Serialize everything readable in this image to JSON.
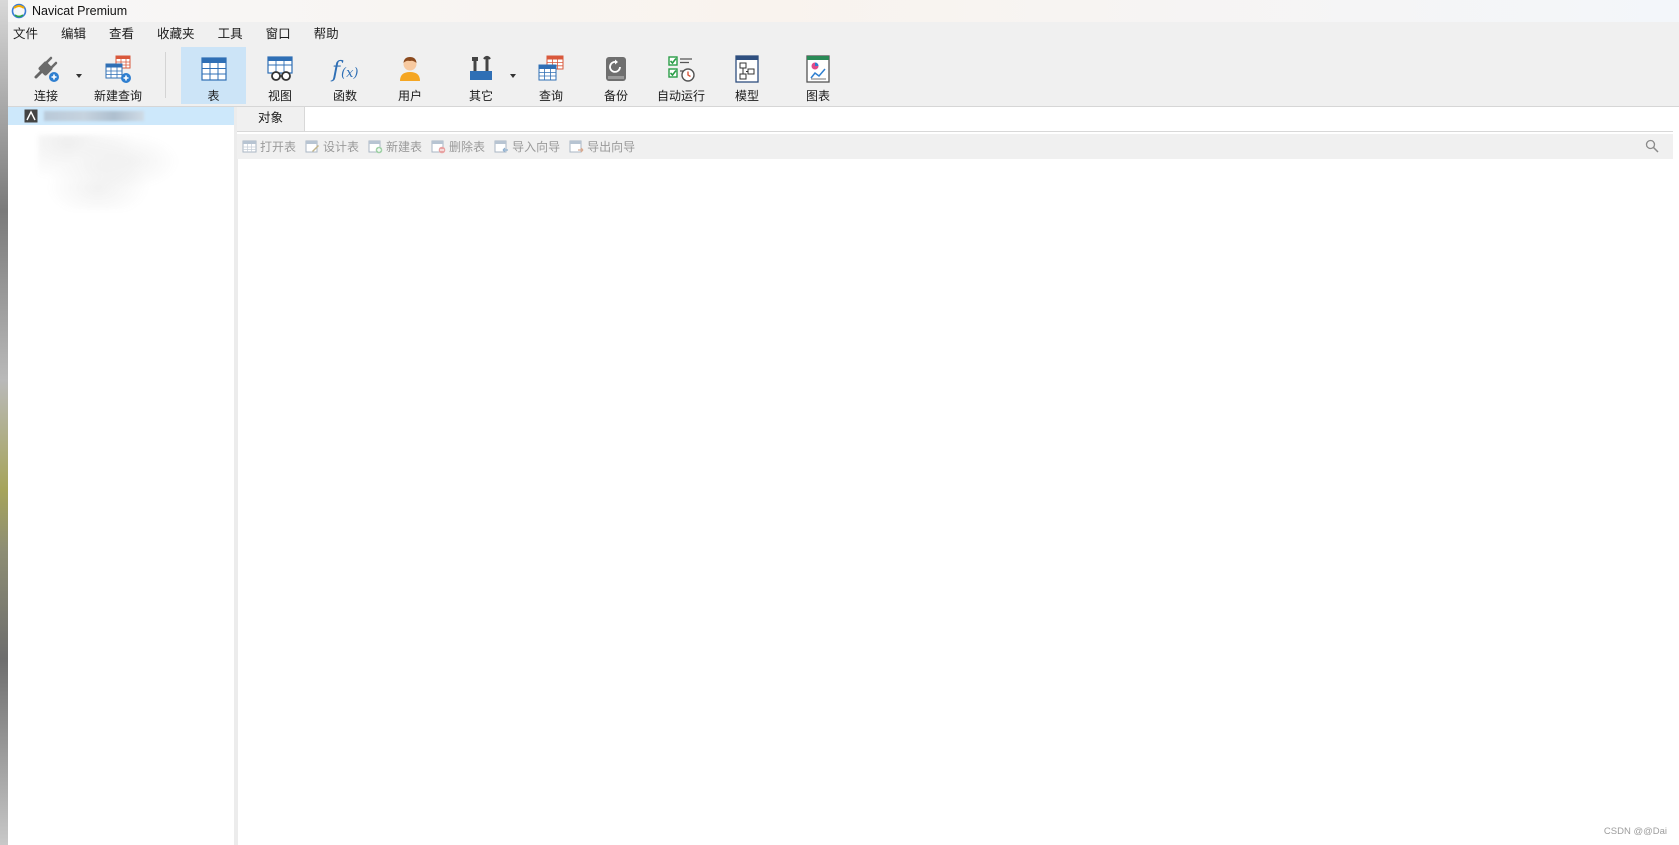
{
  "window": {
    "title": "Navicat Premium"
  },
  "menu": [
    "文件",
    "编辑",
    "查看",
    "收藏夹",
    "工具",
    "窗口",
    "帮助"
  ],
  "toolbar": {
    "connect": "连接",
    "new_query": "新建查询",
    "table": "表",
    "view": "视图",
    "function": "函数",
    "user": "用户",
    "other": "其它",
    "query": "查询",
    "backup": "备份",
    "automation": "自动运行",
    "model": "模型",
    "chart": "图表",
    "active": "表"
  },
  "objects_tab": {
    "label": "对象"
  },
  "object_toolbar": {
    "open_table": "打开表",
    "design_table": "设计表",
    "new_table": "新建表",
    "delete_table": "删除表",
    "import_wizard": "导入向导",
    "export_wizard": "导出向导"
  },
  "watermark": "CSDN @@Dai",
  "colors": {
    "selection": "#cce4f7",
    "connection_row": "#cde8fb",
    "toolbar_bg": "#f0f0f0"
  }
}
